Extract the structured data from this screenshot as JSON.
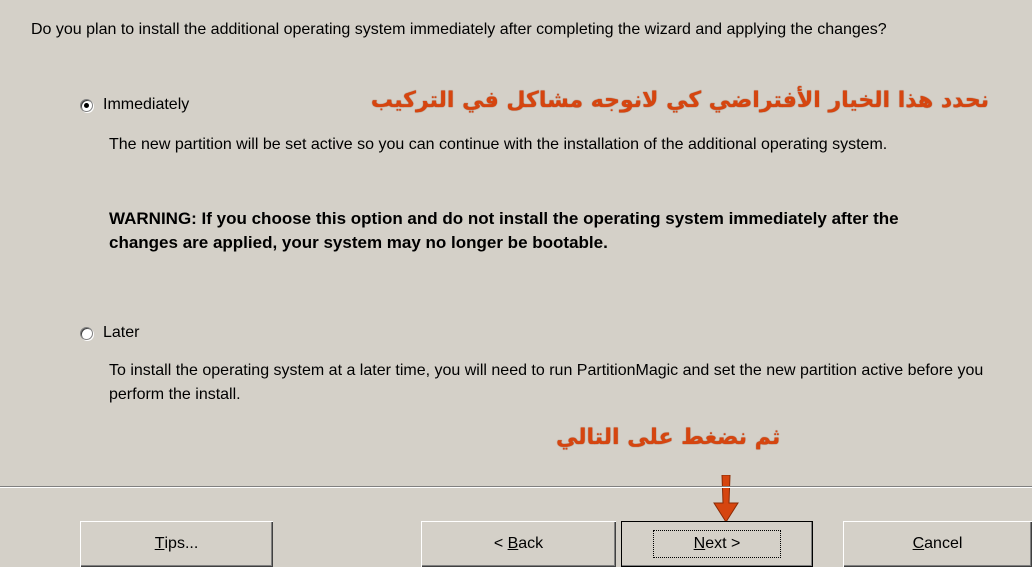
{
  "question": "Do you plan to install the additional operating system immediately after completing the wizard and applying the changes?",
  "options": [
    {
      "label": "Immediately",
      "selected": true,
      "description": "The new partition will be set active so you can continue with the installation of the additional operating system."
    },
    {
      "label": "Later",
      "selected": false,
      "description": "To install the operating system at a later time, you will need to run PartitionMagic and set the new partition active before you perform the install."
    }
  ],
  "warning": "WARNING:  If you choose this option and do not install the operating system immediately after the changes are applied, your system may no longer be bootable.",
  "annotations": {
    "default_choice": "نحدد هذا الخيار الأفتراضي كي لانوجه مشاكل في التركيب",
    "click_next": "ثم نضغط على التالي",
    "color": "#d6450f"
  },
  "buttons": {
    "tips": {
      "mnemonic": "T",
      "rest": "ips..."
    },
    "back": {
      "prefix": "< ",
      "mnemonic": "B",
      "rest": "ack"
    },
    "next": {
      "mnemonic": "N",
      "rest": "ext >"
    },
    "cancel": {
      "mnemonic": "C",
      "rest": "ancel"
    }
  }
}
